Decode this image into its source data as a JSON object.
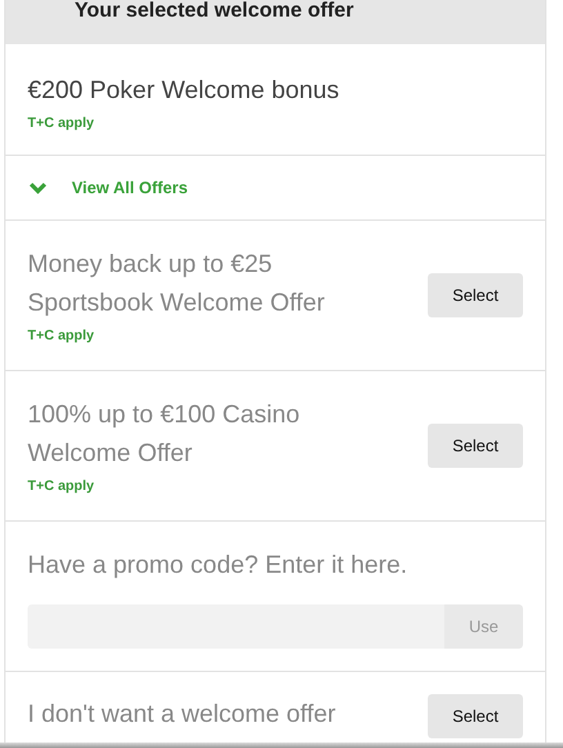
{
  "header": {
    "title": "Your selected welcome offer"
  },
  "selected_offer": {
    "title": "€200 Poker Welcome bonus",
    "terms": "T+C apply"
  },
  "view_all": {
    "label": "View All Offers",
    "expanded": false
  },
  "offers": [
    {
      "title": "Money back up to €25 Sportsbook Welcome Offer",
      "terms": "T+C apply",
      "button": "Select"
    },
    {
      "title": "100% up to €100 Casino Welcome Offer",
      "terms": "T+C apply",
      "button": "Select"
    }
  ],
  "promo": {
    "prompt": "Have a promo code? Enter it here.",
    "button": "Use",
    "button_disabled": true
  },
  "no_offer": {
    "title": "I don't want a welcome offer",
    "button": "Select"
  }
}
